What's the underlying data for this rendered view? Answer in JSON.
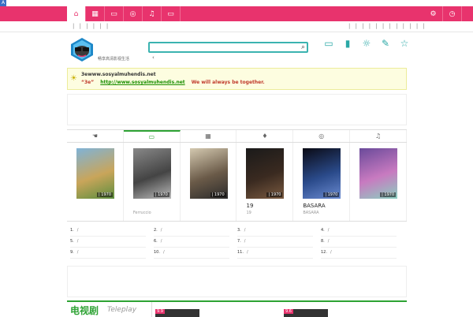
{
  "corner_label": "A",
  "nav": {
    "items": [
      {
        "icon": "home-icon",
        "glyph": "⌂"
      },
      {
        "icon": "film-icon",
        "glyph": "▦"
      },
      {
        "icon": "tv-icon",
        "glyph": "▭"
      },
      {
        "icon": "disc-icon",
        "glyph": "◎"
      },
      {
        "icon": "music-icon",
        "glyph": "♫"
      },
      {
        "icon": "monitor-icon",
        "glyph": "▭"
      }
    ],
    "right": [
      {
        "icon": "gear-icon",
        "glyph": "⚙"
      },
      {
        "icon": "clock-icon",
        "glyph": "◷"
      }
    ]
  },
  "subbar": {
    "left": "| | | | | |",
    "right": "| | | | | | | | | | | |"
  },
  "header": {
    "slogan": "畅享高清影视生活",
    "search_placeholder": "",
    "caret": "‹"
  },
  "notice": {
    "line1": "3ewww.sosyalmuhendis.net",
    "line2_prefix": "“3e”",
    "link": "http://www.sosyalmuhendis.net",
    "line2_suffix": "We will always be together."
  },
  "tabs": [
    {
      "icon": "hand-icon",
      "glyph": "☚"
    },
    {
      "icon": "tv-icon",
      "glyph": "▭"
    },
    {
      "icon": "film-icon",
      "glyph": "▦"
    },
    {
      "icon": "mic-icon",
      "glyph": "♦"
    },
    {
      "icon": "disc-icon",
      "glyph": "◎"
    },
    {
      "icon": "music-icon",
      "glyph": "♫"
    }
  ],
  "posters": [
    {
      "year": "| 1970",
      "title": "",
      "sub": "",
      "colors": [
        "#7fb3d8",
        "#c9a55a",
        "#5c8e3f"
      ]
    },
    {
      "year": "| 1970",
      "title": "",
      "sub": "Ferruccio",
      "colors": [
        "#888",
        "#444",
        "#bbb"
      ]
    },
    {
      "year": "| 1970",
      "title": "",
      "sub": "",
      "colors": [
        "#d4c9b0",
        "#6a5a48",
        "#2b2b2b"
      ]
    },
    {
      "year": "| 1970",
      "title": "19",
      "sub": "19",
      "colors": [
        "#1a1a1a",
        "#3a2a20",
        "#7a5a40"
      ]
    },
    {
      "year": "| 1970",
      "title": "BASARA",
      "sub": "BASARA",
      "colors": [
        "#0a0a14",
        "#2a4a8a",
        "#6a8ad0"
      ]
    },
    {
      "year": "| 1970",
      "title": "",
      "sub": "",
      "colors": [
        "#6a4a9a",
        "#c87ac0",
        "#8ad0c0"
      ]
    }
  ],
  "ranking": [
    {
      "num": "1.",
      "text": "/"
    },
    {
      "num": "2.",
      "text": "/"
    },
    {
      "num": "3.",
      "text": "/"
    },
    {
      "num": "4.",
      "text": "/"
    },
    {
      "num": "5.",
      "text": "/"
    },
    {
      "num": "6.",
      "text": "/"
    },
    {
      "num": "7.",
      "text": "/"
    },
    {
      "num": "8.",
      "text": "/"
    },
    {
      "num": "9.",
      "text": "/"
    },
    {
      "num": "10.",
      "text": "/"
    },
    {
      "num": "11.",
      "text": "/"
    },
    {
      "num": "12.",
      "text": "/"
    }
  ],
  "tv_section": {
    "title": "电视剧",
    "en": "Teleplay",
    "badges": [
      "9.9",
      "9.6"
    ]
  },
  "colors": {
    "accent": "#e8336d",
    "teal": "#3bb3b0",
    "green": "#2ea334"
  }
}
